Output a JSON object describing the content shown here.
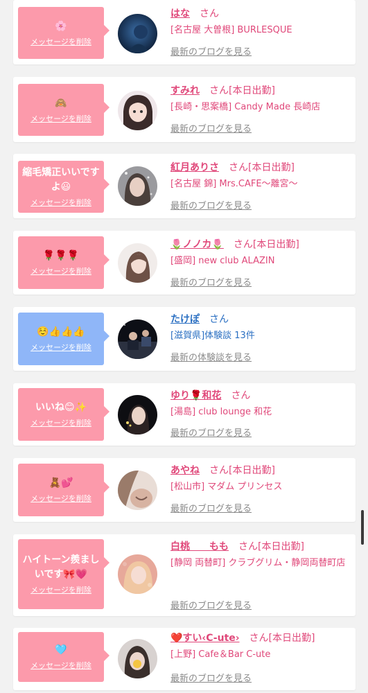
{
  "cards": [
    {
      "message": "🌸",
      "delete_label": "メッセージを削除",
      "name": "はな",
      "honorific": "さん",
      "status": "",
      "shop": "[名古屋 大曽根] BURLESQUE",
      "link": "最新のブログを見る"
    },
    {
      "message": "🙈",
      "delete_label": "メッセージを削除",
      "name": "すみれ",
      "honorific": "さん",
      "status": "[本日出勤]",
      "shop": "[長崎・思案橋] Candy Made 長崎店",
      "link": "最新のブログを見る"
    },
    {
      "message": "縮毛矯正いいですよ😃",
      "delete_label": "メッセージを削除",
      "name": "紅月ありさ",
      "honorific": "さん",
      "status": "[本日出勤]",
      "shop": "[名古屋 錦] Mrs.CAFE〜離宮〜",
      "link": "最新のブログを見る"
    },
    {
      "message": "🌹🌹🌹",
      "delete_label": "メッセージを削除",
      "name": "🌷ノノカ🌷",
      "honorific": "さん",
      "status": "[本日出勤]",
      "shop": "[盛岡] new club ALAZIN",
      "link": "最新のブログを見る"
    },
    {
      "message": "☺️👍👍👍",
      "delete_label": "メッセージを削除",
      "name": "たけぽ",
      "honorific": "さん",
      "status": "",
      "shop": "[滋賀県]体験談 13件",
      "link": "最新の体験談を見る"
    },
    {
      "message": "いいね😊✨",
      "delete_label": "メッセージを削除",
      "name": "ゆり🌹和花",
      "honorific": "さん",
      "status": "",
      "shop": "[湯島] club lounge 和花",
      "link": "最新のブログを見る"
    },
    {
      "message": "🧸💕",
      "delete_label": "メッセージを削除",
      "name": "あやね",
      "honorific": "さん",
      "status": "[本日出勤]",
      "shop": "[松山市] マダム プリンセス",
      "link": "最新のブログを見る"
    },
    {
      "message": "ハイトーン羨ましいです🎀💗",
      "delete_label": "メッセージを削除",
      "name": "白桃　　もも",
      "honorific": "さん",
      "status": "[本日出勤]",
      "shop": "[静岡 両替町] クラブグリム・静岡両替町店",
      "link": "最新のブログを見る"
    },
    {
      "message": "🩵",
      "delete_label": "メッセージを削除",
      "name": "❤️すい‹C-ute›",
      "honorific": "さん",
      "status": "[本日出勤]",
      "shop": "[上野] Cafe＆Bar C-ute",
      "link": "最新のブログを見る"
    }
  ],
  "colors": {
    "bubble_pink": "#fc9aab",
    "bubble_blue": "#8fb6f8",
    "name_pink": "#e0487a",
    "name_blue": "#2a6fc2",
    "link_gray": "#8a8a8a"
  }
}
